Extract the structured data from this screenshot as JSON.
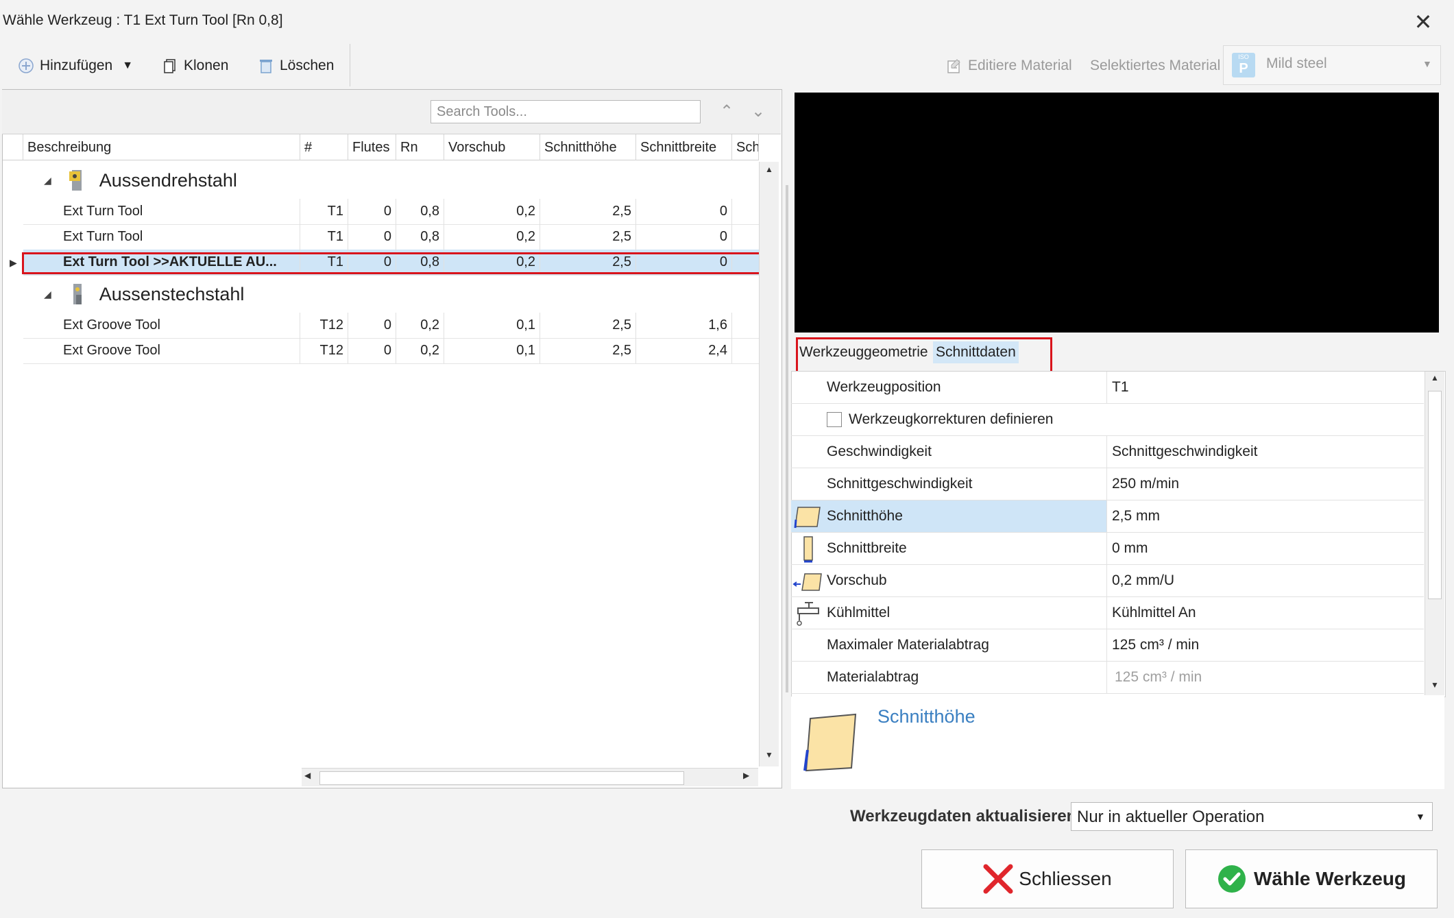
{
  "window": {
    "title": "Wähle Werkzeug : T1 Ext Turn Tool  [Rn 0,8]"
  },
  "toolbar": {
    "add_label": "Hinzufügen",
    "clone_label": "Klonen",
    "delete_label": "Löschen",
    "edit_material_label": "Editiere Material",
    "selected_material_label": "Selektiertes Material",
    "material_badge_top": "ISO",
    "material_badge": "P",
    "material_value": "Mild steel"
  },
  "search": {
    "placeholder": "Search Tools..."
  },
  "table": {
    "columns": [
      "Beschreibung",
      "#",
      "Flutes",
      "Rn",
      "Vorschub",
      "Schnitthöhe",
      "Schnittbreite",
      "Sch"
    ],
    "groups": [
      {
        "name": "Aussendrehstahl",
        "rows": [
          {
            "desc": "Ext Turn Tool",
            "num": "T1",
            "flutes": "0",
            "rn": "0,8",
            "feed": "0,2",
            "height": "2,5",
            "width": "0"
          },
          {
            "desc": "Ext Turn Tool",
            "num": "T1",
            "flutes": "0",
            "rn": "0,8",
            "feed": "0,2",
            "height": "2,5",
            "width": "0"
          },
          {
            "desc": "Ext Turn Tool  >>AKTUELLE AU...",
            "num": "T1",
            "flutes": "0",
            "rn": "0,8",
            "feed": "0,2",
            "height": "2,5",
            "width": "0"
          }
        ]
      },
      {
        "name": "Aussenstechstahl",
        "rows": [
          {
            "desc": "Ext Groove Tool",
            "num": "T12",
            "flutes": "0",
            "rn": "0,2",
            "feed": "0,1",
            "height": "2,5",
            "width": "1,6"
          },
          {
            "desc": "Ext Groove Tool",
            "num": "T12",
            "flutes": "0",
            "rn": "0,2",
            "feed": "0,1",
            "height": "2,5",
            "width": "2,4"
          }
        ]
      }
    ]
  },
  "tabs": {
    "geometry": "Werkzeuggeometrie",
    "cutting": "Schnittdaten"
  },
  "properties": [
    {
      "key": "Werkzeugposition",
      "value": "T1"
    },
    {
      "key": "Werkzeugkorrekturen definieren",
      "value": ""
    },
    {
      "key": "Geschwindigkeit",
      "value": "Schnittgeschwindigkeit"
    },
    {
      "key": "Schnittgeschwindigkeit",
      "value": "250 m/min"
    },
    {
      "key": "Schnitthöhe",
      "value": "2,5 mm"
    },
    {
      "key": "Schnittbreite",
      "value": "0 mm"
    },
    {
      "key": "Vorschub",
      "value": "0,2 mm/U"
    },
    {
      "key": "Kühlmittel",
      "value": "Kühlmittel An"
    },
    {
      "key": "Maximaler Materialabtrag",
      "value": "125 cm³ / min"
    },
    {
      "key": "Materialabtrag",
      "value": "125 cm³ / min"
    }
  ],
  "description": {
    "title": "Schnitthöhe"
  },
  "update": {
    "label": "Werkzeugdaten aktualisieren",
    "value": "Nur in aktueller Operation"
  },
  "buttons": {
    "close": "Schliessen",
    "choose": "Wähle Werkzeug"
  },
  "colors": {
    "accent": "#3a7fc1",
    "selection": "#cfe5f7",
    "highlight": "#d9141c"
  }
}
